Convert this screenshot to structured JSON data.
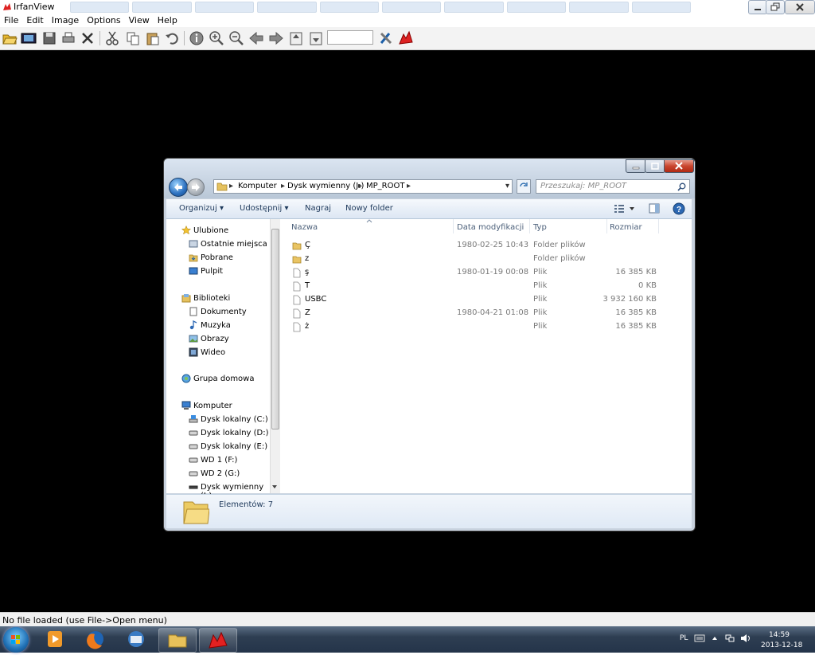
{
  "app": {
    "title": "IrfanView",
    "menu": [
      "File",
      "Edit",
      "Image",
      "Options",
      "View",
      "Help"
    ],
    "zoom_value": "",
    "status": "No file loaded (use File->Open menu)"
  },
  "toolbar": {
    "icons": [
      "open-folder-icon",
      "slideshow-icon",
      "save-icon",
      "print-icon",
      "delete-icon",
      "cut-icon",
      "copy-icon",
      "paste-icon",
      "undo-icon",
      "info-icon",
      "zoom-in-icon",
      "zoom-out-icon",
      "previous-icon",
      "next-icon",
      "first-page-icon",
      "last-page-icon",
      "settings-icon",
      "irfanview-icon"
    ]
  },
  "explorer": {
    "breadcrumb": [
      "Komputer",
      "Dysk wymienny (J:)",
      "MP_ROOT"
    ],
    "search_placeholder": "Przeszukaj: MP_ROOT",
    "commands": [
      "Organizuj",
      "Udostępnij",
      "Nagraj",
      "Nowy folder"
    ],
    "nav": {
      "favorites": {
        "label": "Ulubione",
        "items": [
          "Ostatnie miejsca",
          "Pobrane",
          "Pulpit"
        ]
      },
      "libraries": {
        "label": "Biblioteki",
        "items": [
          "Dokumenty",
          "Muzyka",
          "Obrazy",
          "Wideo"
        ]
      },
      "homegroup": {
        "label": "Grupa domowa"
      },
      "computer": {
        "label": "Komputer",
        "items": [
          "Dysk lokalny (C:)",
          "Dysk lokalny (D:)",
          "Dysk lokalny (E:)",
          "WD 1 (F:)",
          "WD 2 (G:)",
          "Dysk wymienny (J:)"
        ]
      }
    },
    "columns": {
      "name": "Nazwa",
      "date": "Data modyfikacji",
      "type": "Typ",
      "size": "Rozmiar"
    },
    "files": [
      {
        "name": "Ç",
        "date": "1980-02-25 10:43",
        "type": "Folder plików",
        "size": "",
        "icon": "folder-icon"
      },
      {
        "name": "z",
        "date": "",
        "type": "Folder plików",
        "size": "",
        "icon": "folder-icon"
      },
      {
        "name": "ş",
        "date": "1980-01-19 00:08",
        "type": "Plik",
        "size": "16 385 KB",
        "icon": "file-icon"
      },
      {
        "name": "T",
        "date": "",
        "type": "Plik",
        "size": "0 KB",
        "icon": "file-icon"
      },
      {
        "name": "USBC",
        "date": "",
        "type": "Plik",
        "size": "3 932 160 KB",
        "icon": "file-icon"
      },
      {
        "name": "Z",
        "date": "1980-04-21 01:08",
        "type": "Plik",
        "size": "16 385 KB",
        "icon": "file-icon"
      },
      {
        "name": "ż",
        "date": "",
        "type": "Plik",
        "size": "16 385 KB",
        "icon": "file-icon"
      }
    ],
    "item_count": "Elementów: 7"
  },
  "taskbar": {
    "language": "PL",
    "time": "14:59",
    "date": "2013-12-18"
  }
}
